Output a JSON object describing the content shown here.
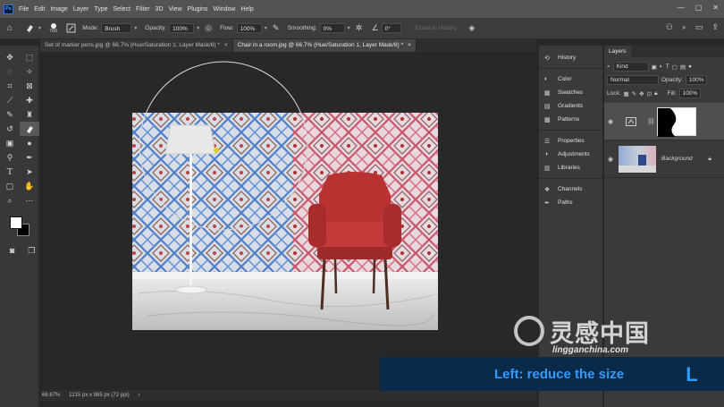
{
  "app": {
    "logo": "Ps",
    "menu": [
      "File",
      "Edit",
      "Image",
      "Layer",
      "Type",
      "Select",
      "Filter",
      "3D",
      "View",
      "Plugins",
      "Window",
      "Help"
    ],
    "window_controls": [
      "—",
      "▢",
      "✕"
    ]
  },
  "options": {
    "brush_size": "700",
    "mode_label": "Mode:",
    "mode_value": "Brush",
    "opacity_label": "Opacity:",
    "opacity_value": "100%",
    "flow_label": "Flow:",
    "flow_value": "100%",
    "smoothing_label": "Smoothing:",
    "smoothing_value": "0%",
    "angle_value": "0°",
    "erase_history": "Erase to History"
  },
  "tabs": [
    {
      "label": "Set of marker pens.jpg @ 66.7% (Hue/Saturation 1, Layer Mask/8) *",
      "close": "×"
    },
    {
      "label": "Chair in a room.jpg @ 66.7% (Hue/Saturation 1, Layer Mask/8) *",
      "close": "×"
    }
  ],
  "status": {
    "zoom": "66.67%",
    "doc": "1215 px x 865 px (72 ppi)",
    "arrow": "›"
  },
  "panels": {
    "group1": [
      "History"
    ],
    "group2": [
      "Color",
      "Swatches",
      "Gradients",
      "Patterns"
    ],
    "group3": [
      "Properties",
      "Adjustments",
      "Libraries"
    ],
    "group4": [
      "Channels",
      "Paths"
    ]
  },
  "layers": {
    "title": "Layers",
    "filter": "Kind",
    "blend": "Normal",
    "opacity_label": "Opacity:",
    "opacity_value": "100%",
    "lock_label": "Lock:",
    "fill_label": "Fill:",
    "fill_value": "100%",
    "items": [
      {
        "name": ""
      },
      {
        "name": "Background"
      }
    ]
  },
  "watermark": {
    "cn": "灵感中国",
    "url": "lingganchina.com"
  },
  "tip": {
    "text": "Left: reduce the size",
    "key": "L"
  }
}
